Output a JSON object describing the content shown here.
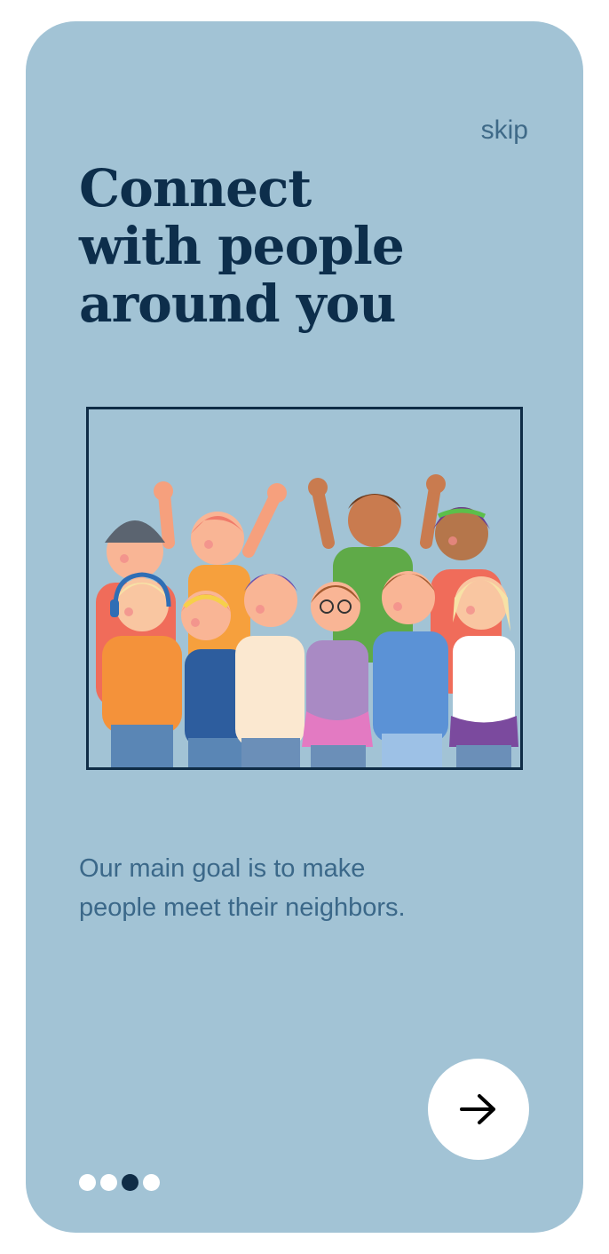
{
  "onboarding": {
    "skip_label": "skip",
    "title_lines": [
      "Connect",
      "with people",
      "around you"
    ],
    "illustration": "group-of-people-illustration",
    "description_lines": [
      "Our main goal is to make",
      "people meet their neighbors."
    ],
    "next_icon": "arrow-right-icon",
    "pagination": {
      "total": 4,
      "active_index": 2
    }
  },
  "colors": {
    "background": "#a2c3d5",
    "title": "#0d2e4b",
    "body_text": "#3b6889",
    "accent_dark": "#0f2c46",
    "button": "#ffffff"
  }
}
